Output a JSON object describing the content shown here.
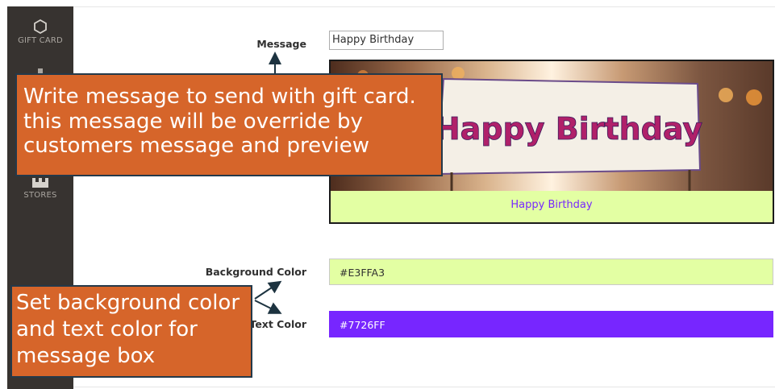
{
  "sidebar": {
    "items": [
      {
        "label": "GIFT CARD",
        "icon": "hexagon-icon"
      },
      {
        "label": "STORES",
        "icon": "store-icon"
      }
    ]
  },
  "form": {
    "message_label": "Message",
    "message_value": "Happy Birthday",
    "preview": {
      "banner_text": "Happy Birthday",
      "message_text": "Happy Birthday",
      "background": "#E3FFA3",
      "text_color": "#7726FF"
    },
    "background_color_label": "Background Color",
    "background_color_value": "#E3FFA3",
    "text_color_label": "Text Color",
    "text_color_value": "#7726FF"
  },
  "annotations": {
    "callout_message": [
      "Write message to send with gift card.",
      "this message will be override by",
      "customers message and preview"
    ],
    "callout_colors": [
      "Set background color",
      "and text color for",
      "message box"
    ],
    "callout_bg": "#D6652A"
  }
}
